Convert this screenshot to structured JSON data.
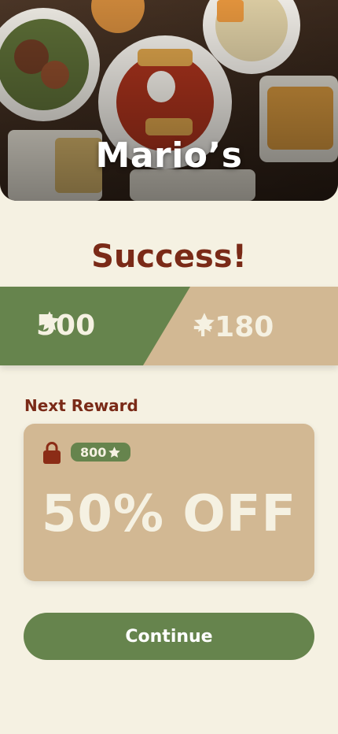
{
  "hero": {
    "restaurant_name": "Mario’s"
  },
  "result": {
    "title": "Success!"
  },
  "points": {
    "current": "500",
    "earned": "+180"
  },
  "next_reward": {
    "label": "Next Reward",
    "cost": "800",
    "reward": "50% OFF"
  },
  "actions": {
    "continue_label": "Continue"
  },
  "icons": {
    "star": "star-icon",
    "lock": "lock-icon"
  },
  "colors": {
    "background": "#f5f1e2",
    "green": "#66844d",
    "tan": "#d2b893",
    "brown": "#7a2a17"
  }
}
